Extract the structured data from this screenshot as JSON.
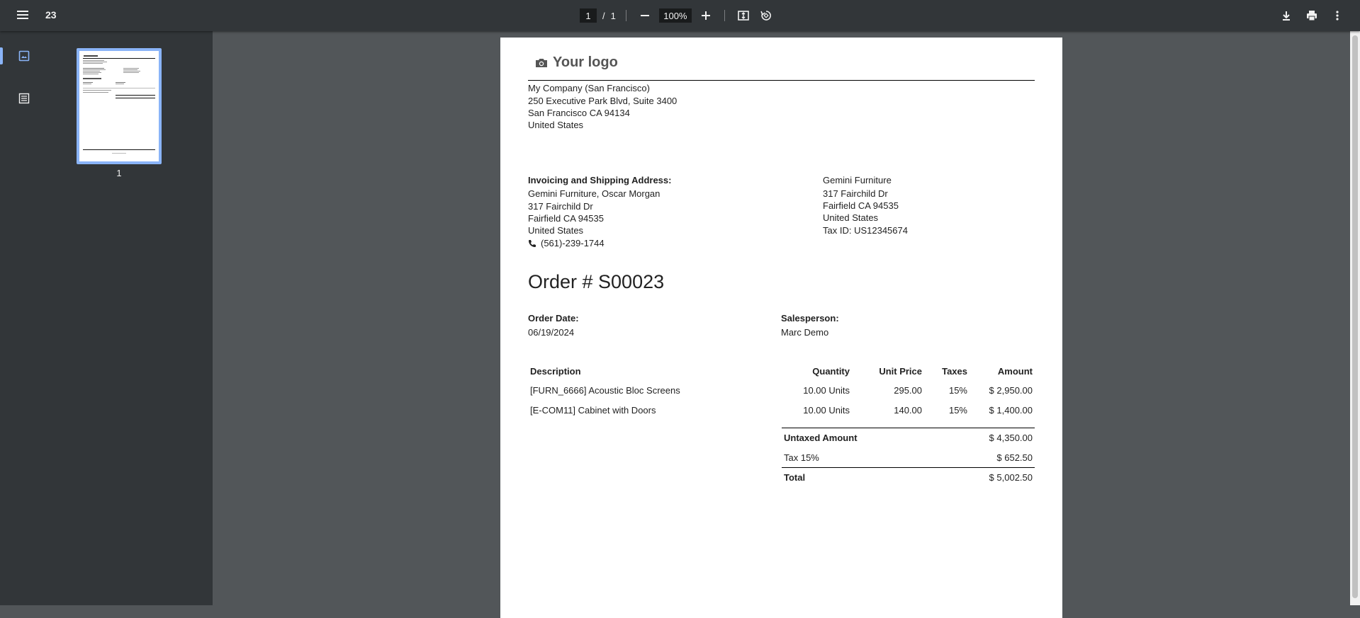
{
  "toolbar": {
    "title": "23",
    "page_current": "1",
    "page_sep": "/",
    "page_total": "1",
    "zoom": "100%"
  },
  "sidebar": {
    "thumbnail_label": "1"
  },
  "document": {
    "logo_text": "Your logo",
    "company": {
      "name": "My Company (San Francisco)",
      "street": "250 Executive Park Blvd, Suite 3400",
      "city": "San Francisco CA 94134",
      "country": "United States"
    },
    "invoicing": {
      "heading": "Invoicing and Shipping Address:",
      "name": "Gemini Furniture, Oscar Morgan",
      "street": "317 Fairchild Dr",
      "city": "Fairfield CA 94535",
      "country": "United States",
      "phone": "(561)-239-1744"
    },
    "customer": {
      "name": "Gemini Furniture",
      "street": "317 Fairchild Dr",
      "city": "Fairfield CA 94535",
      "country": "United States",
      "tax_id": "Tax ID: US12345674"
    },
    "order_title": "Order # S00023",
    "order_date_label": "Order Date:",
    "order_date": "06/19/2024",
    "salesperson_label": "Salesperson:",
    "salesperson": "Marc Demo",
    "table_headers": {
      "description": "Description",
      "quantity": "Quantity",
      "unit_price": "Unit Price",
      "taxes": "Taxes",
      "amount": "Amount"
    },
    "lines": [
      {
        "description": "[FURN_6666] Acoustic Bloc Screens",
        "quantity": "10.00 Units",
        "unit_price": "295.00",
        "taxes": "15%",
        "amount": "$ 2,950.00"
      },
      {
        "description": "[E-COM11] Cabinet with Doors",
        "quantity": "10.00 Units",
        "unit_price": "140.00",
        "taxes": "15%",
        "amount": "$ 1,400.00"
      }
    ],
    "totals": {
      "untaxed_label": "Untaxed Amount",
      "untaxed_value": "$ 4,350.00",
      "tax_label": "Tax 15%",
      "tax_value": "$ 652.50",
      "total_label": "Total",
      "total_value": "$ 5,002.50"
    }
  }
}
